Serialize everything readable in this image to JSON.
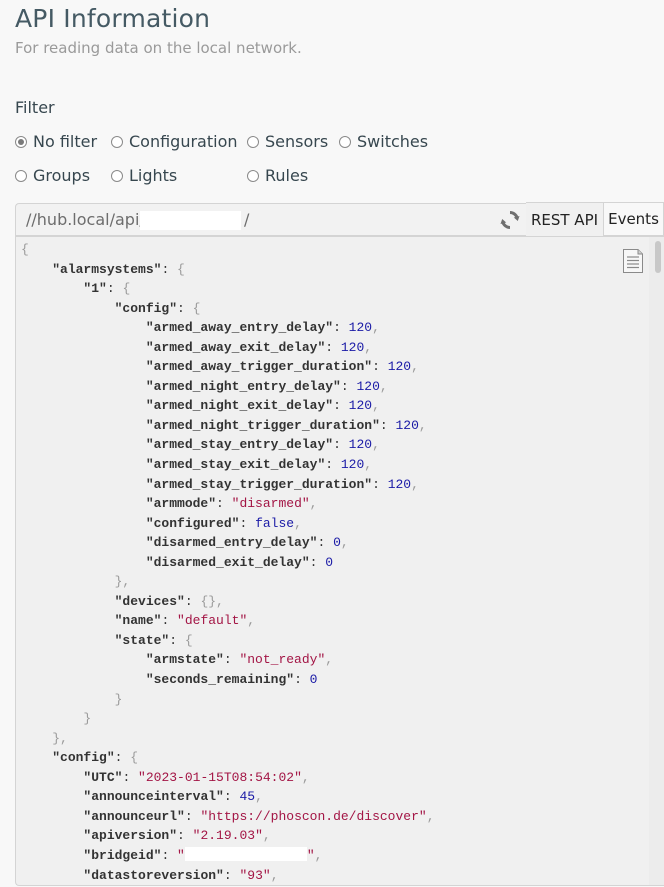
{
  "header": {
    "title": "API Information",
    "subtitle": "For reading data on the local network."
  },
  "filter": {
    "label": "Filter",
    "options": [
      {
        "label": "No filter",
        "checked": true
      },
      {
        "label": "Configuration",
        "checked": false
      },
      {
        "label": "Sensors",
        "checked": false
      },
      {
        "label": "Switches",
        "checked": false
      },
      {
        "label": "Groups",
        "checked": false
      },
      {
        "label": "Lights",
        "checked": false
      },
      {
        "label": "Rules",
        "checked": false
      }
    ]
  },
  "urlbar": {
    "prefix": "//hub.local/api/",
    "api_key": "",
    "suffix": "/"
  },
  "tabs": [
    {
      "label": "REST API",
      "active": true
    },
    {
      "label": "Events",
      "active": false
    }
  ],
  "icons": {
    "refresh": "refresh-icon",
    "copy": "clipboard-copy-icon"
  },
  "colors": {
    "json_key": "#333333",
    "json_number": "#1a1aa6",
    "json_string": "#a31545",
    "json_punct": "#9a9a9a",
    "panel_bg": "#f0f0f0"
  },
  "json_lines": [
    {
      "indent": 0,
      "tokens": [
        {
          "t": "p",
          "v": "{"
        }
      ]
    },
    {
      "indent": 1,
      "tokens": [
        {
          "t": "k",
          "v": "\"alarmsystems\""
        },
        {
          "t": "c",
          "v": ": "
        },
        {
          "t": "p",
          "v": "{"
        }
      ]
    },
    {
      "indent": 2,
      "tokens": [
        {
          "t": "k",
          "v": "\"1\""
        },
        {
          "t": "c",
          "v": ": "
        },
        {
          "t": "p",
          "v": "{"
        }
      ]
    },
    {
      "indent": 3,
      "tokens": [
        {
          "t": "k",
          "v": "\"config\""
        },
        {
          "t": "c",
          "v": ": "
        },
        {
          "t": "p",
          "v": "{"
        }
      ]
    },
    {
      "indent": 4,
      "tokens": [
        {
          "t": "k",
          "v": "\"armed_away_entry_delay\""
        },
        {
          "t": "c",
          "v": ": "
        },
        {
          "t": "n",
          "v": "120"
        },
        {
          "t": "p",
          "v": ","
        }
      ]
    },
    {
      "indent": 4,
      "tokens": [
        {
          "t": "k",
          "v": "\"armed_away_exit_delay\""
        },
        {
          "t": "c",
          "v": ": "
        },
        {
          "t": "n",
          "v": "120"
        },
        {
          "t": "p",
          "v": ","
        }
      ]
    },
    {
      "indent": 4,
      "tokens": [
        {
          "t": "k",
          "v": "\"armed_away_trigger_duration\""
        },
        {
          "t": "c",
          "v": ": "
        },
        {
          "t": "n",
          "v": "120"
        },
        {
          "t": "p",
          "v": ","
        }
      ]
    },
    {
      "indent": 4,
      "tokens": [
        {
          "t": "k",
          "v": "\"armed_night_entry_delay\""
        },
        {
          "t": "c",
          "v": ": "
        },
        {
          "t": "n",
          "v": "120"
        },
        {
          "t": "p",
          "v": ","
        }
      ]
    },
    {
      "indent": 4,
      "tokens": [
        {
          "t": "k",
          "v": "\"armed_night_exit_delay\""
        },
        {
          "t": "c",
          "v": ": "
        },
        {
          "t": "n",
          "v": "120"
        },
        {
          "t": "p",
          "v": ","
        }
      ]
    },
    {
      "indent": 4,
      "tokens": [
        {
          "t": "k",
          "v": "\"armed_night_trigger_duration\""
        },
        {
          "t": "c",
          "v": ": "
        },
        {
          "t": "n",
          "v": "120"
        },
        {
          "t": "p",
          "v": ","
        }
      ]
    },
    {
      "indent": 4,
      "tokens": [
        {
          "t": "k",
          "v": "\"armed_stay_entry_delay\""
        },
        {
          "t": "c",
          "v": ": "
        },
        {
          "t": "n",
          "v": "120"
        },
        {
          "t": "p",
          "v": ","
        }
      ]
    },
    {
      "indent": 4,
      "tokens": [
        {
          "t": "k",
          "v": "\"armed_stay_exit_delay\""
        },
        {
          "t": "c",
          "v": ": "
        },
        {
          "t": "n",
          "v": "120"
        },
        {
          "t": "p",
          "v": ","
        }
      ]
    },
    {
      "indent": 4,
      "tokens": [
        {
          "t": "k",
          "v": "\"armed_stay_trigger_duration\""
        },
        {
          "t": "c",
          "v": ": "
        },
        {
          "t": "n",
          "v": "120"
        },
        {
          "t": "p",
          "v": ","
        }
      ]
    },
    {
      "indent": 4,
      "tokens": [
        {
          "t": "k",
          "v": "\"armmode\""
        },
        {
          "t": "c",
          "v": ": "
        },
        {
          "t": "s",
          "v": "\"disarmed\""
        },
        {
          "t": "p",
          "v": ","
        }
      ]
    },
    {
      "indent": 4,
      "tokens": [
        {
          "t": "k",
          "v": "\"configured\""
        },
        {
          "t": "c",
          "v": ": "
        },
        {
          "t": "n",
          "v": "false"
        },
        {
          "t": "p",
          "v": ","
        }
      ]
    },
    {
      "indent": 4,
      "tokens": [
        {
          "t": "k",
          "v": "\"disarmed_entry_delay\""
        },
        {
          "t": "c",
          "v": ": "
        },
        {
          "t": "n",
          "v": "0"
        },
        {
          "t": "p",
          "v": ","
        }
      ]
    },
    {
      "indent": 4,
      "tokens": [
        {
          "t": "k",
          "v": "\"disarmed_exit_delay\""
        },
        {
          "t": "c",
          "v": ": "
        },
        {
          "t": "n",
          "v": "0"
        }
      ]
    },
    {
      "indent": 3,
      "tokens": [
        {
          "t": "p",
          "v": "},"
        }
      ]
    },
    {
      "indent": 3,
      "tokens": [
        {
          "t": "k",
          "v": "\"devices\""
        },
        {
          "t": "c",
          "v": ": "
        },
        {
          "t": "p",
          "v": "{},"
        }
      ]
    },
    {
      "indent": 3,
      "tokens": [
        {
          "t": "k",
          "v": "\"name\""
        },
        {
          "t": "c",
          "v": ": "
        },
        {
          "t": "s",
          "v": "\"default\""
        },
        {
          "t": "p",
          "v": ","
        }
      ]
    },
    {
      "indent": 3,
      "tokens": [
        {
          "t": "k",
          "v": "\"state\""
        },
        {
          "t": "c",
          "v": ": "
        },
        {
          "t": "p",
          "v": "{"
        }
      ]
    },
    {
      "indent": 4,
      "tokens": [
        {
          "t": "k",
          "v": "\"armstate\""
        },
        {
          "t": "c",
          "v": ": "
        },
        {
          "t": "s",
          "v": "\"not_ready\""
        },
        {
          "t": "p",
          "v": ","
        }
      ]
    },
    {
      "indent": 4,
      "tokens": [
        {
          "t": "k",
          "v": "\"seconds_remaining\""
        },
        {
          "t": "c",
          "v": ": "
        },
        {
          "t": "n",
          "v": "0"
        }
      ]
    },
    {
      "indent": 3,
      "tokens": [
        {
          "t": "p",
          "v": "}"
        }
      ]
    },
    {
      "indent": 2,
      "tokens": [
        {
          "t": "p",
          "v": "}"
        }
      ]
    },
    {
      "indent": 1,
      "tokens": [
        {
          "t": "p",
          "v": "},"
        }
      ]
    },
    {
      "indent": 1,
      "tokens": [
        {
          "t": "k",
          "v": "\"config\""
        },
        {
          "t": "c",
          "v": ": "
        },
        {
          "t": "p",
          "v": "{"
        }
      ]
    },
    {
      "indent": 2,
      "tokens": [
        {
          "t": "k",
          "v": "\"UTC\""
        },
        {
          "t": "c",
          "v": ": "
        },
        {
          "t": "s",
          "v": "\"2023-01-15T08:54:02\""
        },
        {
          "t": "p",
          "v": ","
        }
      ]
    },
    {
      "indent": 2,
      "tokens": [
        {
          "t": "k",
          "v": "\"announceinterval\""
        },
        {
          "t": "c",
          "v": ": "
        },
        {
          "t": "n",
          "v": "45"
        },
        {
          "t": "p",
          "v": ","
        }
      ]
    },
    {
      "indent": 2,
      "tokens": [
        {
          "t": "k",
          "v": "\"announceurl\""
        },
        {
          "t": "c",
          "v": ": "
        },
        {
          "t": "s",
          "v": "\"https://phoscon.de/discover\""
        },
        {
          "t": "p",
          "v": ","
        }
      ]
    },
    {
      "indent": 2,
      "tokens": [
        {
          "t": "k",
          "v": "\"apiversion\""
        },
        {
          "t": "c",
          "v": ": "
        },
        {
          "t": "s",
          "v": "\"2.19.03\""
        },
        {
          "t": "p",
          "v": ","
        }
      ]
    },
    {
      "indent": 2,
      "tokens": [
        {
          "t": "k",
          "v": "\"bridgeid\""
        },
        {
          "t": "c",
          "v": ": "
        },
        {
          "t": "s",
          "v": "\""
        },
        {
          "t": "r",
          "v": ""
        },
        {
          "t": "s",
          "v": "\""
        },
        {
          "t": "p",
          "v": ","
        }
      ]
    },
    {
      "indent": 2,
      "tokens": [
        {
          "t": "k",
          "v": "\"datastoreversion\""
        },
        {
          "t": "c",
          "v": ": "
        },
        {
          "t": "s",
          "v": "\"93\""
        },
        {
          "t": "p",
          "v": ","
        }
      ]
    }
  ]
}
